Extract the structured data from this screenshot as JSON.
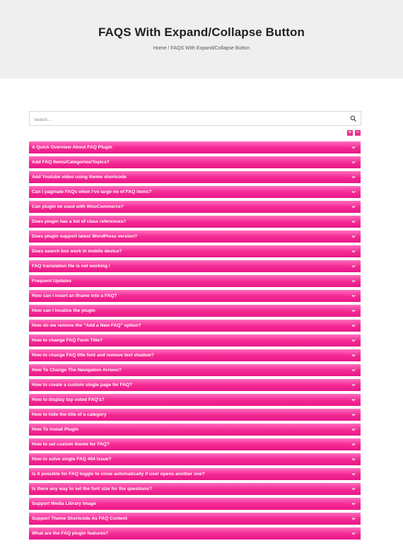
{
  "header": {
    "title": "FAQS With Expand/Collapse Button",
    "breadcrumb": {
      "home": "Home",
      "separator": " / ",
      "current": "FAQS With Expand/Collapse Button"
    }
  },
  "search": {
    "placeholder": "Search..."
  },
  "toggles": {
    "expand_all": "+",
    "collapse_all": "–"
  },
  "colors": {
    "accent": "#e91788",
    "header_bg": "#efefef"
  },
  "faqs": [
    "A Quick Overview About FAQ Plugin",
    "Add FAQ Items/Categories/Topics?",
    "Add Youtube video using theme shortcode",
    "Can I paginate FAQs when I've large no of FAQ items?",
    "Can plugin be used with WooCommerce?",
    "Does plugin has a list of class references?",
    "Does plugin support latest WordPress version?",
    "Does search box work in mobile device?",
    "FAQ translation file is not working !",
    "Frequent Updates",
    "How can I insert an Iframe into a FAQ?",
    "How can I localize the plugin",
    "How do we remove the \"Add a New FAQ\" option?",
    "How to change FAQ Form Title?",
    "How to change FAQ title font and remove text shadow?",
    "How To Change The Navigation Arrows?",
    "How to create a custom single page for FAQ?",
    "How to display top voted FAQ's?",
    "How to hide the title of a category",
    "How To Install Plugin",
    "How to set custom theme for FAQ?",
    "How to solve single FAQ 404 issue?",
    "Is it possible for FAQ toggle to close automatically if user opens another one?",
    "Is there any way to set the font size for the questions?",
    "Support Media Library Image",
    "Support Theme Shortcode As FAQ Content",
    "What are the FAQ plugin features?"
  ]
}
